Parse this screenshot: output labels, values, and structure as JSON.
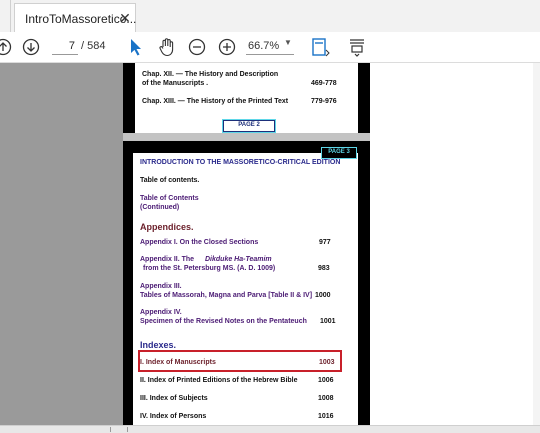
{
  "tab": {
    "title": "IntroToMassoretico...",
    "close_glyph": "✕"
  },
  "toolbar": {
    "prev_icon": "arrow-up-circle-icon",
    "next_icon": "arrow-down-circle-icon",
    "current_page": "7",
    "total_pages": "/ 584",
    "select_icon": "cursor-arrow-icon",
    "hand_icon": "hand-tool-icon",
    "zoom_out_icon": "minus-circle-icon",
    "zoom_in_icon": "plus-circle-icon",
    "zoom": "66.7%",
    "fit_icon": "fit-page-icon",
    "scroll_icon": "scroll-mode-icon"
  },
  "page1": {
    "row1_title": "Chap. XII. — The History and Description",
    "row1_title2": "of the Manuscripts .",
    "row1_pages": "469-778",
    "row2_title": "Chap. XIII. — The History of the Printed Text",
    "row2_pages": "779-976",
    "badge": "PAGE 2"
  },
  "page2": {
    "badge": "PAGE 3",
    "heading": "INTRODUCTION TO THE MASSORETICO-CRITICAL EDITION",
    "toc": "Table of contents.",
    "toc_link": "Table of Contents",
    "toc_cont": "(Continued)",
    "appendices_head": "Appendices.",
    "app1": "Appendix I. On the Closed Sections",
    "app1_page": "977",
    "app2_a": "Appendix II. The",
    "app2_b": "Dikduke Ha-Teamim",
    "app2_line2": "from the St. Petersburg MS. (A. D. 1009)",
    "app2_page": "983",
    "app3_line1": "Appendix III.",
    "app3_line2": "Tables of Massorah, Magna and Parva [Table II & IV]",
    "app3_page": "1000",
    "app4_line1": "Appendix IV.",
    "app4_line2": "Specimen of the Revised Notes on the Pentateuch",
    "app4_page": "1001",
    "indexes_head": "Indexes.",
    "idx1": "I. Index of Manuscripts",
    "idx1_page": "1003",
    "idx2": "II. Index of Printed Editions of the Hebrew  Bible",
    "idx2_page": "1006",
    "idx3": "III. Index of Subjects",
    "idx3_page": "1008",
    "idx4": "IV. Index of Persons",
    "idx4_page": "1016"
  },
  "colors": {
    "highlight": "#c8202a",
    "accent": "#1a73c7",
    "badge_cyan": "#5fd7e8",
    "heading_navy": "#2a2a8c"
  }
}
